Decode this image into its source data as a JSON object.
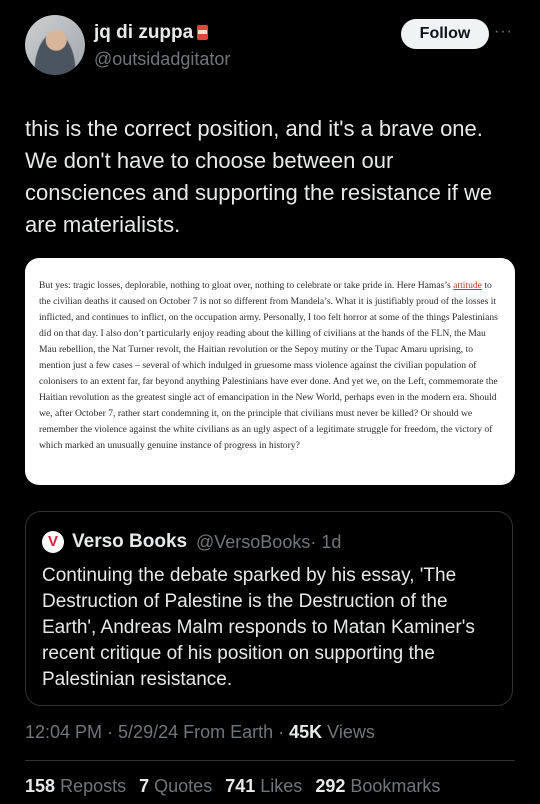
{
  "author": {
    "name": "jq di zuppa",
    "emoji_icon": "soup-can-icon",
    "handle": "@outsidadgitator",
    "follow_label": "Follow",
    "more_label": "···"
  },
  "tweet": {
    "text": "this is the correct position, and it's a brave one. We don't have to choose between our consciences and supporting the resistance if we are materialists."
  },
  "image": {
    "text_before_link": "But yes: tragic losses, deplorable, nothing to gloat over, nothing to celebrate or take pride in. Here Hamas’s ",
    "link_text": "attitude",
    "text_after_link": " to the civilian deaths it caused on October 7 is not so different from Mandela’s. What it is justifiably proud of the losses it inflicted, and continues to inflict, on the occupation army. Personally, I too felt horror at some of the things Palestinians did on that day. I also don’t particularly enjoy reading about the killing of civilians at the hands of the FLN, the Mau Mau rebellion, the Nat Turner revolt, the Haitian revolution or the Sepoy mutiny or the Tupac Amaru uprising, to mention just a few cases – several of which indulged in gruesome mass violence against the civilian population of colonisers to an extent far, far beyond anything Palestinians have ever done. And yet we, on the Left, commemorate the Haitian revolution as the greatest single act of emancipation in the New World, perhaps even in the modern era. Should we, after October 7, rather start condemning it, on the principle that civilians must never be killed? Or should we remember the violence against the white civilians as an ugly aspect of a legitimate struggle for freedom, the victory of which marked an unusually genuine instance of progress in history?"
  },
  "quote": {
    "logo_letter": "V",
    "name": "Verso Books",
    "handle": "@VersoBooks",
    "time": "· 1d",
    "text": "Continuing the debate sparked by his essay, 'The Destruction of Palestine is the Destruction of the Earth', Andreas Malm responds to Matan Kaminer's recent critique of his position on supporting the Palestinian resistance."
  },
  "meta": {
    "time_date": "12:04 PM · 5/29/24 From Earth · ",
    "views_count": "45K",
    "views_label": " Views"
  },
  "stats": {
    "reposts_count": "158",
    "reposts_label": "Reposts",
    "quotes_count": "7",
    "quotes_label": "Quotes",
    "likes_count": "741",
    "likes_label": "Likes",
    "bookmarks_count": "292",
    "bookmarks_label": "Bookmarks"
  }
}
